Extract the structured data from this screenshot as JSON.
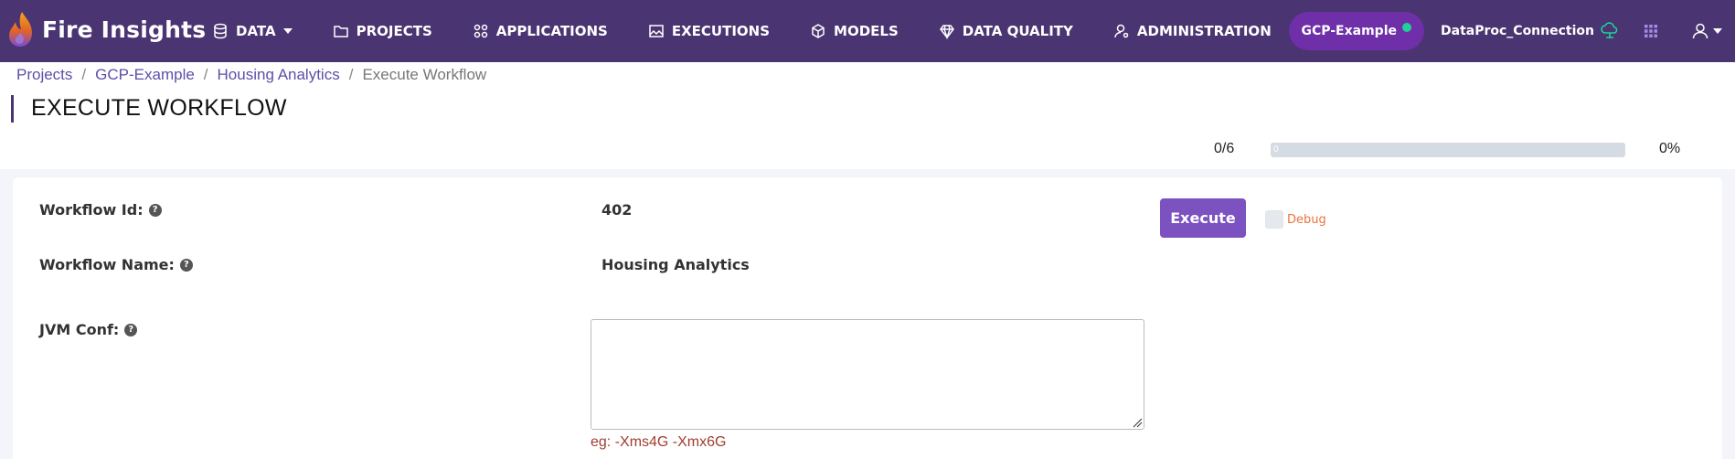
{
  "brand": {
    "name": "Fire Insights"
  },
  "nav": {
    "items": [
      {
        "label": "DATA",
        "icon": "database-icon",
        "dropdown": true
      },
      {
        "label": "PROJECTS",
        "icon": "folder-icon"
      },
      {
        "label": "APPLICATIONS",
        "icon": "apps-icon"
      },
      {
        "label": "EXECUTIONS",
        "icon": "image-icon"
      },
      {
        "label": "MODELS",
        "icon": "cube-icon"
      },
      {
        "label": "DATA QUALITY",
        "icon": "diamond-icon"
      },
      {
        "label": "ADMINISTRATION",
        "icon": "user-gear-icon"
      }
    ],
    "project": "GCP-Example",
    "connection": "DataProc_Connection"
  },
  "breadcrumb": {
    "items": [
      "Projects",
      "GCP-Example",
      "Housing Analytics"
    ],
    "current": "Execute Workflow"
  },
  "page": {
    "title": "EXECUTE WORKFLOW",
    "progress": {
      "count": "0/6",
      "percent_label": "0%",
      "value": 0,
      "bar_label": "0"
    }
  },
  "form": {
    "workflow_id_label": "Workflow Id:",
    "workflow_id": "402",
    "workflow_name_label": "Workflow Name:",
    "workflow_name": "Housing Analytics",
    "jvm_conf_label": "JVM Conf:",
    "jvm_conf_value": "",
    "jvm_hint": "eg: -Xms4G -Xmx6G",
    "execute_label": "Execute",
    "debug_label": "Debug"
  },
  "colors": {
    "navbar": "#4a3471",
    "accent": "#7b52c0",
    "pill": "#6e2fa8",
    "status_online": "#1fd09a",
    "debug_label": "#e8743b",
    "hint": "#a23d2e"
  }
}
